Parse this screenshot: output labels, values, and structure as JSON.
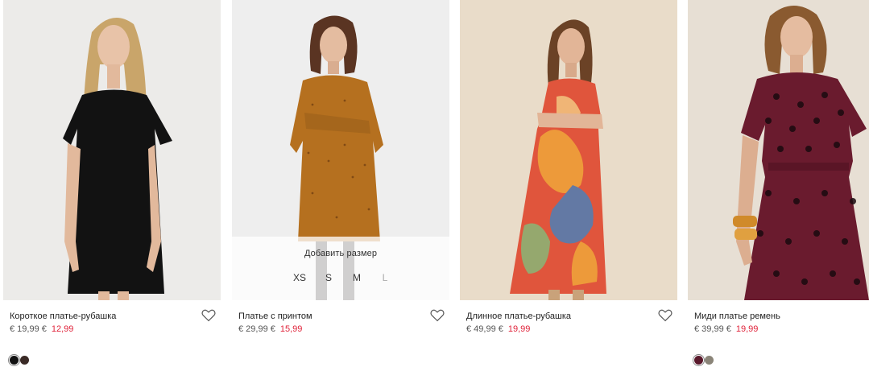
{
  "products": [
    {
      "name": "Короткое платье-рубашка",
      "price_old": "€ 19,99 €",
      "price_sale": "12,99",
      "swatches": [
        "#111111",
        "#3a2a26"
      ]
    },
    {
      "name": "Платье с принтом",
      "price_old": "€ 29,99 €",
      "price_sale": "15,99",
      "overlay": {
        "title": "Добавить размер",
        "sizes": [
          "XS",
          "S",
          "M",
          "L"
        ]
      }
    },
    {
      "name": "Длинное платье-рубашка",
      "price_old": "€ 49,99 €",
      "price_sale": "19,99"
    },
    {
      "name": "Миди платье ремень",
      "price_old": "€ 39,99 €",
      "price_sale": "19,99",
      "swatches": [
        "#5a1a2c",
        "#8a8478"
      ]
    }
  ],
  "icons": {
    "wishlist": "heart-outline-icon"
  },
  "colors": {
    "sale": "#e0243b"
  }
}
